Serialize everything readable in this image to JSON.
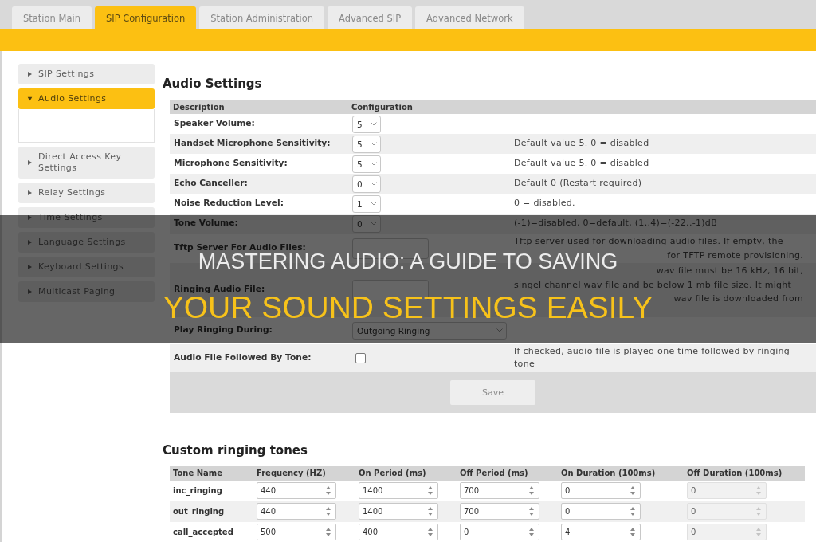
{
  "tabs": [
    {
      "label": "Station Main",
      "selected": false
    },
    {
      "label": "SIP Configuration",
      "selected": true
    },
    {
      "label": "Station Administration",
      "selected": false
    },
    {
      "label": "Advanced SIP",
      "selected": false
    },
    {
      "label": "Advanced Network",
      "selected": false
    }
  ],
  "sidebar": {
    "items": [
      {
        "label": "SIP Settings",
        "selected": false,
        "expanded": false
      },
      {
        "label": "Audio Settings",
        "selected": true,
        "expanded": true
      },
      {
        "label": "Direct Access Key Settings",
        "selected": false,
        "expanded": false
      },
      {
        "label": "Relay Settings",
        "selected": false,
        "expanded": false
      },
      {
        "label": "Time Settings",
        "selected": false,
        "expanded": false
      },
      {
        "label": "Language Settings",
        "selected": false,
        "expanded": false
      },
      {
        "label": "Keyboard Settings",
        "selected": false,
        "expanded": false
      },
      {
        "label": "Multicast Paging",
        "selected": false,
        "expanded": false
      }
    ]
  },
  "audio_settings": {
    "title": "Audio Settings",
    "columns": [
      "Description",
      "Configuration"
    ],
    "rows": [
      {
        "label": "Speaker Volume:",
        "control": {
          "kind": "select",
          "value": "5"
        }
      },
      {
        "label": "Handset Microphone Sensitivity:",
        "control": {
          "kind": "select",
          "value": "5"
        },
        "note": "Default value 5. 0 = disabled"
      },
      {
        "label": "Microphone Sensitivity:",
        "control": {
          "kind": "select",
          "value": "5"
        },
        "note": "Default value 5. 0 = disabled"
      },
      {
        "label": "Echo Canceller:",
        "control": {
          "kind": "select",
          "value": "0"
        },
        "note": "Default 0 (Restart required)"
      },
      {
        "label": "Noise Reduction Level:",
        "control": {
          "kind": "select",
          "value": "1"
        },
        "note": "0 = disabled."
      },
      {
        "label": "Tone Volume:",
        "control": {
          "kind": "select",
          "value": "0"
        },
        "note": "(-1)=disabled, 0=default, (1..4)=(-22..-1)dB"
      },
      {
        "label": "Tftp Server For Audio Files:",
        "control": {
          "kind": "input"
        },
        "note_fragments": [
          {
            "kind": "line",
            "text": "Tftp server used for downloading audio files. If empty, the"
          },
          {
            "kind": "tail",
            "text": "for TFTP remote provisioning."
          }
        ]
      },
      {
        "label": "Ringing Audio File:",
        "control": {
          "kind": "input"
        },
        "note_fragments": [
          {
            "kind": "tail",
            "text": "wav file must be 16 kHz, 16 bit,"
          },
          {
            "kind": "line",
            "text": "singel channel wav file and be below 1 mb file size. It might"
          },
          {
            "kind": "tail",
            "text": "wav file is downloaded from"
          }
        ]
      },
      {
        "label": "Play Ringing During:",
        "control": {
          "kind": "dropdown",
          "value": "Outgoing Ringing"
        }
      },
      {
        "label": "Audio File Followed By Tone:",
        "control": {
          "kind": "checkbox",
          "checked": false
        },
        "note": "If checked, audio file is played one time followed by ringing tone"
      }
    ],
    "save_button": "Save"
  },
  "custom_ringing_tones": {
    "title": "Custom ringing tones",
    "columns": [
      "Tone Name",
      "Frequency (HZ)",
      "On Period (ms)",
      "Off Period (ms)",
      "On Duration (100ms)",
      "Off Duration (100ms)"
    ],
    "rows": [
      {
        "cells": [
          {
            "kind": "name",
            "value": "inc_ringing",
            "disabled": false
          },
          {
            "kind": "number",
            "value": "440",
            "disabled": false
          },
          {
            "kind": "number",
            "value": "1400",
            "disabled": false
          },
          {
            "kind": "number",
            "value": "700",
            "disabled": false
          },
          {
            "kind": "number",
            "value": "0",
            "disabled": false
          },
          {
            "kind": "number",
            "value": "0",
            "disabled": true
          }
        ]
      },
      {
        "cells": [
          {
            "kind": "name",
            "value": "out_ringing",
            "disabled": false
          },
          {
            "kind": "number",
            "value": "440",
            "disabled": false
          },
          {
            "kind": "number",
            "value": "1400",
            "disabled": false
          },
          {
            "kind": "number",
            "value": "700",
            "disabled": false
          },
          {
            "kind": "number",
            "value": "0",
            "disabled": false
          },
          {
            "kind": "number",
            "value": "0",
            "disabled": true
          }
        ]
      },
      {
        "cells": [
          {
            "kind": "name",
            "value": "call_accepted",
            "disabled": false
          },
          {
            "kind": "number",
            "value": "500",
            "disabled": false
          },
          {
            "kind": "number",
            "value": "400",
            "disabled": false
          },
          {
            "kind": "number",
            "value": "0",
            "disabled": false
          },
          {
            "kind": "number",
            "value": "4",
            "disabled": false
          },
          {
            "kind": "number",
            "value": "0",
            "disabled": true
          }
        ]
      }
    ]
  },
  "banner": {
    "lines": [
      {
        "kind": "plain",
        "text": "MASTERING AUDIO: A GUIDE TO SAVING"
      },
      {
        "kind": "highlight",
        "text": "YOUR SOUND SETTINGS EASILY"
      }
    ]
  }
}
